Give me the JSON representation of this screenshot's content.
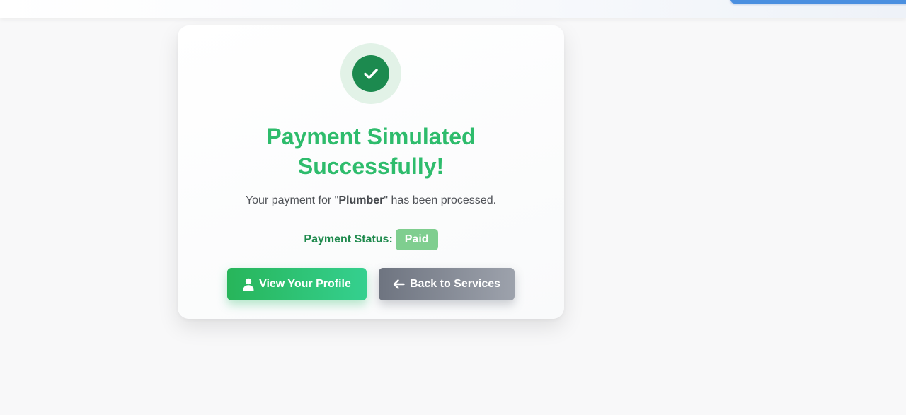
{
  "colors": {
    "accent": "#2ebc6c",
    "success_dark": "#1c8a4f",
    "badge": "#7fce8f",
    "secondary_button": "#7d828d"
  },
  "icons": {
    "success": "check-icon",
    "profile_button": "user-icon",
    "back_button": "arrow-left-icon"
  },
  "card": {
    "title": "Payment Simulated Successfully!",
    "message_prefix": "Your payment for \"",
    "service_name": "Plumber",
    "message_suffix": "\" has been processed.",
    "status_label": "Payment Status:",
    "status_value": "Paid"
  },
  "actions": {
    "profile_label": "View Your Profile",
    "back_label": "Back to Services"
  }
}
